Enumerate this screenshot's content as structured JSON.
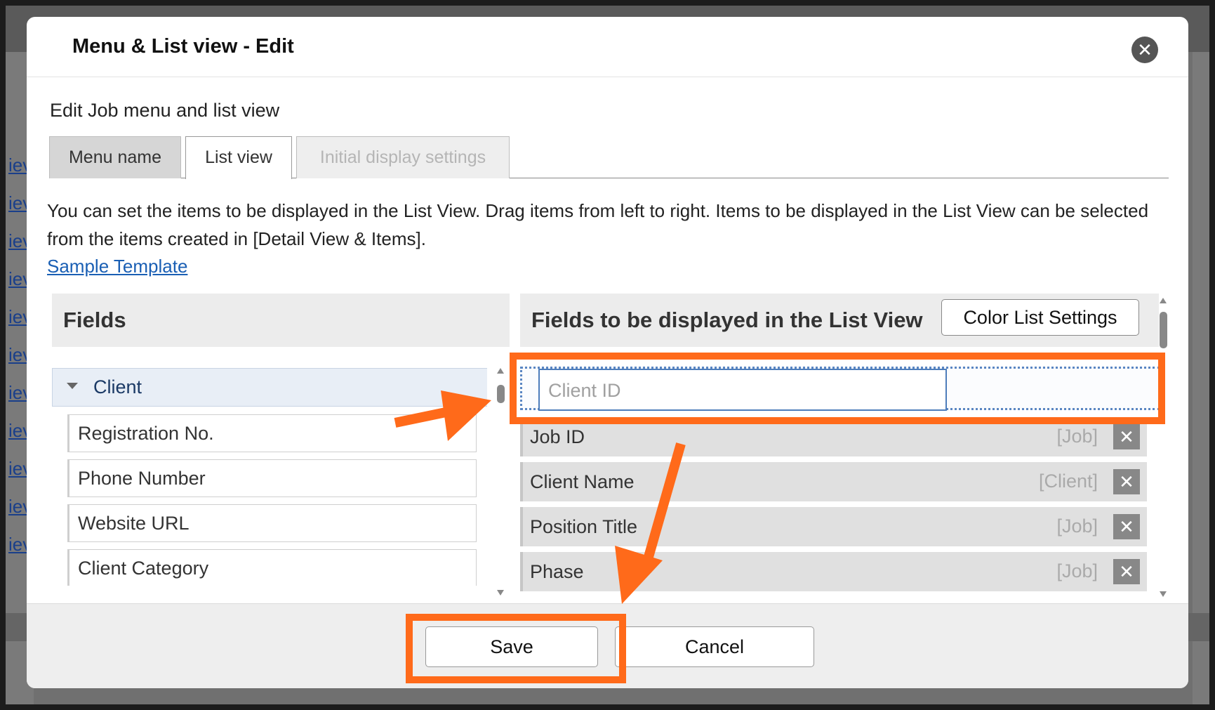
{
  "background": {
    "links": [
      "iev",
      "iev",
      "iev",
      "iev",
      "iev",
      "iev",
      "iev",
      "iev",
      "iev",
      "iev",
      "iev"
    ]
  },
  "modal": {
    "title": "Menu & List view - Edit",
    "subtitle": "Edit Job menu and list view",
    "tabs": [
      {
        "label": "Menu name",
        "state": "inactive"
      },
      {
        "label": "List view",
        "state": "active"
      },
      {
        "label": "Initial display settings",
        "state": "disabled"
      }
    ],
    "description": "You can set the items to be displayed in the List View. Drag items from left to right. Items to be displayed in the List View can be selected from the items created in [Detail View & Items].",
    "sample_link": "Sample Template",
    "fields_panel": {
      "title": "Fields",
      "group": "Client",
      "items": [
        "Registration No.",
        "Phone Number",
        "Website URL",
        "Client Category"
      ]
    },
    "display_panel": {
      "title": "Fields to be displayed in the List View",
      "color_button": "Color List Settings",
      "drop_placeholder": "Client ID",
      "items": [
        {
          "name": "Job ID",
          "tag": "[Job]"
        },
        {
          "name": "Client Name",
          "tag": "[Client]"
        },
        {
          "name": "Position Title",
          "tag": "[Job]"
        },
        {
          "name": "Phase",
          "tag": "[Job]"
        }
      ],
      "remove_symbol": "✕"
    },
    "footer": {
      "save_label": "Save",
      "cancel_label": "Cancel"
    },
    "close_symbol": "✕"
  },
  "annotation": {
    "color": "#ff6a1a"
  }
}
